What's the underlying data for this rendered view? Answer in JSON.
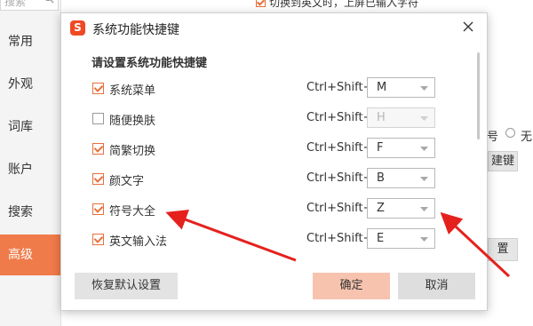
{
  "background": {
    "search": {
      "placeholder": "搜索"
    },
    "nav": [
      {
        "label": "常用",
        "active": false
      },
      {
        "label": "外观",
        "active": false
      },
      {
        "label": "词库",
        "active": false
      },
      {
        "label": "账户",
        "active": false
      },
      {
        "label": "搜索",
        "active": false
      },
      {
        "label": "高级",
        "active": true
      }
    ],
    "top_option_label": "切换到英文时，上屏已输入字符",
    "radio_fragment_left": "号",
    "radio_fragment_right": "无",
    "button_fragment_1": "建键",
    "button_fragment_2": "置"
  },
  "dialog": {
    "logo_letter": "S",
    "title": "系统功能快捷键",
    "section_title": "请设置系统功能快捷键",
    "rows": [
      {
        "label": "系统菜单",
        "checked": true,
        "modifier": "Ctrl+Shift+",
        "key": "M"
      },
      {
        "label": "随便换肤",
        "checked": false,
        "modifier": "Ctrl+Shift+",
        "key": "H"
      },
      {
        "label": "简繁切换",
        "checked": true,
        "modifier": "Ctrl+Shift+",
        "key": "F"
      },
      {
        "label": "颜文字",
        "checked": true,
        "modifier": "Ctrl+Shift+",
        "key": "B"
      },
      {
        "label": "符号大全",
        "checked": true,
        "modifier": "Ctrl+Shift+",
        "key": "Z"
      },
      {
        "label": "英文输入法",
        "checked": true,
        "modifier": "Ctrl+Shift+",
        "key": "E"
      }
    ],
    "buttons": {
      "reset": "恢复默认设置",
      "ok": "确定",
      "cancel": "取消"
    }
  },
  "colors": {
    "accent": "#f07b4a",
    "checkbox": "#e8703c",
    "arrow": "#e5211d",
    "ok_button": "#f7c3ae"
  }
}
